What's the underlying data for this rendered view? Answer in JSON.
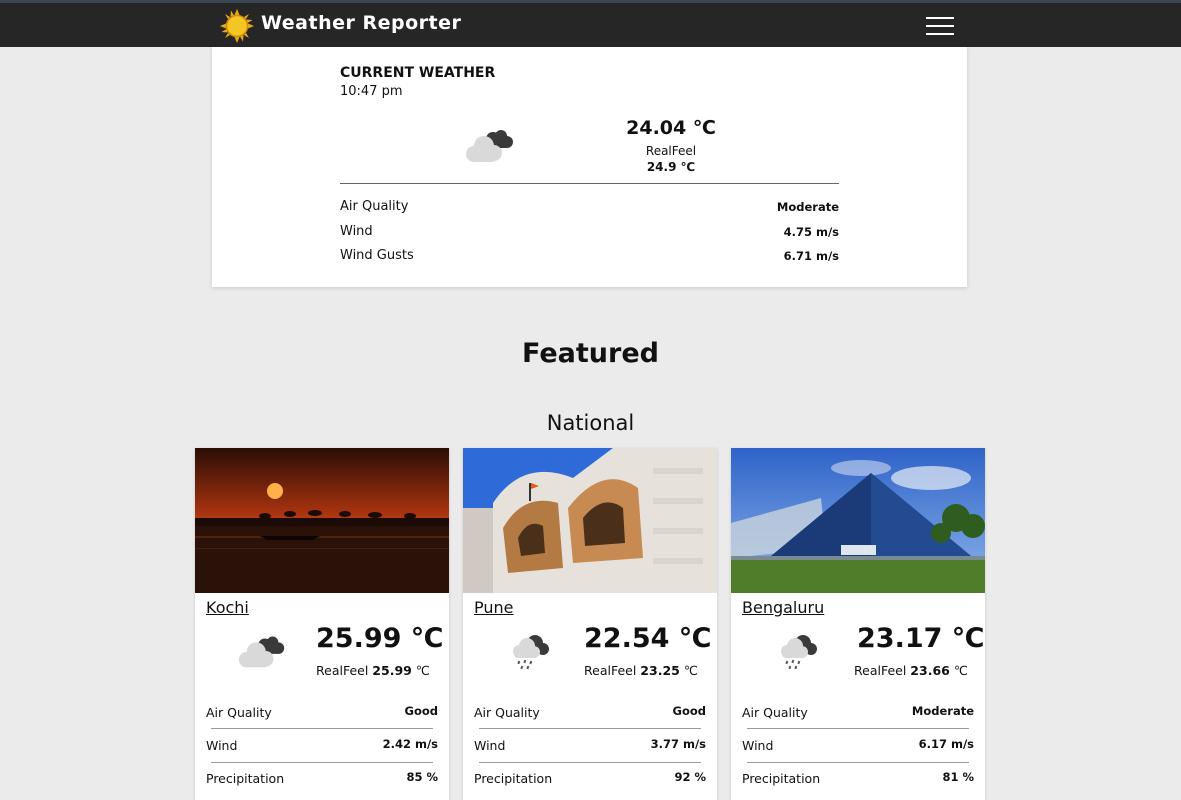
{
  "header": {
    "brand": "Weather Reporter",
    "logo_icon": "sun-icon",
    "menu_icon": "hamburger-menu-icon"
  },
  "current": {
    "title": "CURRENT WEATHER",
    "time": "10:47 pm",
    "icon": "cloudy-night-icon",
    "temperature": "24.04 ℃",
    "realfeel_label": "RealFeel",
    "realfeel_value": "24.9 ℃",
    "rows": [
      {
        "label": "Air Quality",
        "value": "Moderate"
      },
      {
        "label": "Wind",
        "value": "4.75 m/s"
      },
      {
        "label": "Wind Gusts",
        "value": "6.71 m/s"
      }
    ]
  },
  "featured": {
    "title": "Featured",
    "subtitle": "National"
  },
  "cities": [
    {
      "name": "Kochi",
      "icon": "cloudy-night-icon",
      "temperature": "25.99 ℃",
      "realfeel_label": "RealFeel",
      "realfeel_value": "25.99",
      "realfeel_unit": "℃",
      "air_quality_label": "Air Quality",
      "air_quality": "Good",
      "wind_label": "Wind",
      "wind": "2.42 m/s",
      "precip_label": "Precipitation",
      "precip": "85 %"
    },
    {
      "name": "Pune",
      "icon": "rain-night-icon",
      "temperature": "22.54 ℃",
      "realfeel_label": "RealFeel",
      "realfeel_value": "23.25",
      "realfeel_unit": "℃",
      "air_quality_label": "Air Quality",
      "air_quality": "Good",
      "wind_label": "Wind",
      "wind": "3.77 m/s",
      "precip_label": "Precipitation",
      "precip": "92 %"
    },
    {
      "name": "Bengaluru",
      "icon": "rain-night-icon",
      "temperature": "23.17 ℃",
      "realfeel_label": "RealFeel",
      "realfeel_value": "23.66",
      "realfeel_unit": "℃",
      "air_quality_label": "Air Quality",
      "air_quality": "Moderate",
      "wind_label": "Wind",
      "wind": "6.17 m/s",
      "precip_label": "Precipitation",
      "precip": "81 %"
    }
  ]
}
